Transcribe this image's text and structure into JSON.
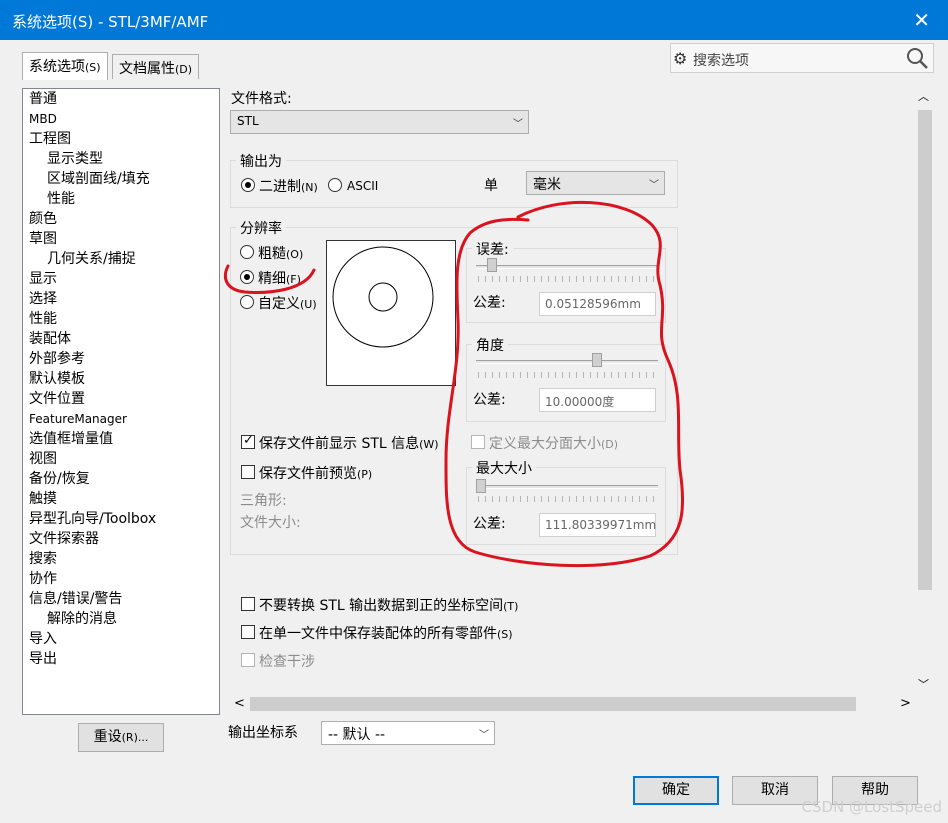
{
  "window": {
    "title": "系统选项(S) - STL/3MF/AMF",
    "close_glyph": "✕"
  },
  "tabs": [
    {
      "label": "系统选项",
      "accel": "(S)"
    },
    {
      "label": "文档属性",
      "accel": "(D)"
    }
  ],
  "search": {
    "placeholder": "搜索选项"
  },
  "tree": [
    "普通",
    "MBD",
    "工程图",
    "显示类型",
    "区域剖面线/填充",
    "性能",
    "颜色",
    "草图",
    "几何关系/捕捉",
    "显示",
    "选择",
    "性能",
    "装配体",
    "外部参考",
    "默认模板",
    "文件位置",
    "FeatureManager",
    "选值框增量值",
    "视图",
    "备份/恢复",
    "触摸",
    "异型孔向导/Toolbox",
    "文件探索器",
    "搜索",
    "协作",
    "信息/错误/警告",
    "解除的消息",
    "导入",
    "导出"
  ],
  "reset_button": {
    "label": "重设",
    "accel": "(R)..."
  },
  "file_format": {
    "label": "文件格式:",
    "value": "STL"
  },
  "output": {
    "group_label": "输出为",
    "binary_label": "二进制",
    "binary_accel": "(N)",
    "ascii_label": "ASCII",
    "unit_label": "单",
    "unit_value": "毫米"
  },
  "resolution": {
    "group_label": "分辨率",
    "coarse_label": "粗糙",
    "coarse_accel": "(O)",
    "fine_label": "精细",
    "fine_accel": "(F)",
    "custom_label": "自定义",
    "custom_accel": "(U)",
    "deviation_label": "误差:",
    "deviation_tol_label": "公差:",
    "deviation_value": "0.05128596mm",
    "angle_label": "角度",
    "angle_tol_label": "公差:",
    "angle_value": "10.00000度",
    "show_info_label": "保存文件前显示 STL 信息",
    "show_info_accel": "(W)",
    "max_face_label": "定义最大分面大小",
    "max_face_accel": "(D)",
    "preview_label": "保存文件前预览",
    "preview_accel": "(P)",
    "max_size_label": "最大大小",
    "max_size_tol_label": "公差:",
    "max_size_value": "111.80339971mm",
    "triangles_label": "三角形:",
    "filesize_label": "文件大小:"
  },
  "options": {
    "no_transform_label": "不要转换 STL 输出数据到正的坐标空间",
    "no_transform_accel": "(T)",
    "single_file_label": "在单一文件中保存装配体的所有零部件",
    "single_file_accel": "(S)",
    "interference_label": "检查干涉"
  },
  "output_coord": {
    "label": "输出坐标系",
    "value": "-- 默认 --"
  },
  "footer": {
    "ok": "确定",
    "cancel": "取消",
    "help": "帮助"
  },
  "scroll": {
    "left": "<",
    "right": ">",
    "up": "︿",
    "down": "﹀"
  },
  "watermark": "CSDN @LostSpeed",
  "colors": {
    "title_bar": "#0078d7",
    "annotation": "#d9141e"
  }
}
